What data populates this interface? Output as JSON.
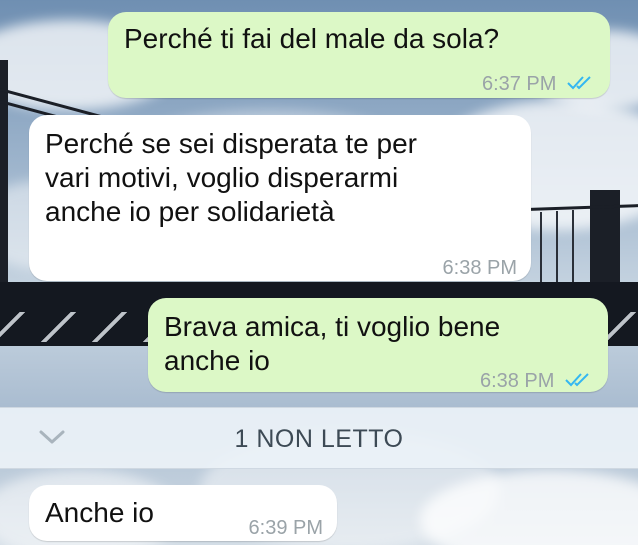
{
  "messages": [
    {
      "text": "Perché ti fai del male da sola?",
      "time": "6:37 PM",
      "direction": "outgoing",
      "status": "read-double-check"
    },
    {
      "text": "Perché se sei disperata te per\nvari motivi, voglio disperarmi\nanche io per solidarietà",
      "time": "6:38 PM",
      "direction": "incoming"
    },
    {
      "text": "Brava amica, ti voglio bene\nanche io",
      "time": "6:38 PM",
      "direction": "outgoing",
      "status": "read-double-check"
    },
    {
      "text": "Anche io",
      "time": "6:39 PM",
      "direction": "incoming"
    }
  ],
  "unread_divider": {
    "label": "1 NON LETTO"
  },
  "colors": {
    "outgoing_bubble": "#dcf8c6",
    "incoming_bubble": "#ffffff",
    "read_ticks": "#34b7f1",
    "timestamp": "#9aa3a8"
  }
}
